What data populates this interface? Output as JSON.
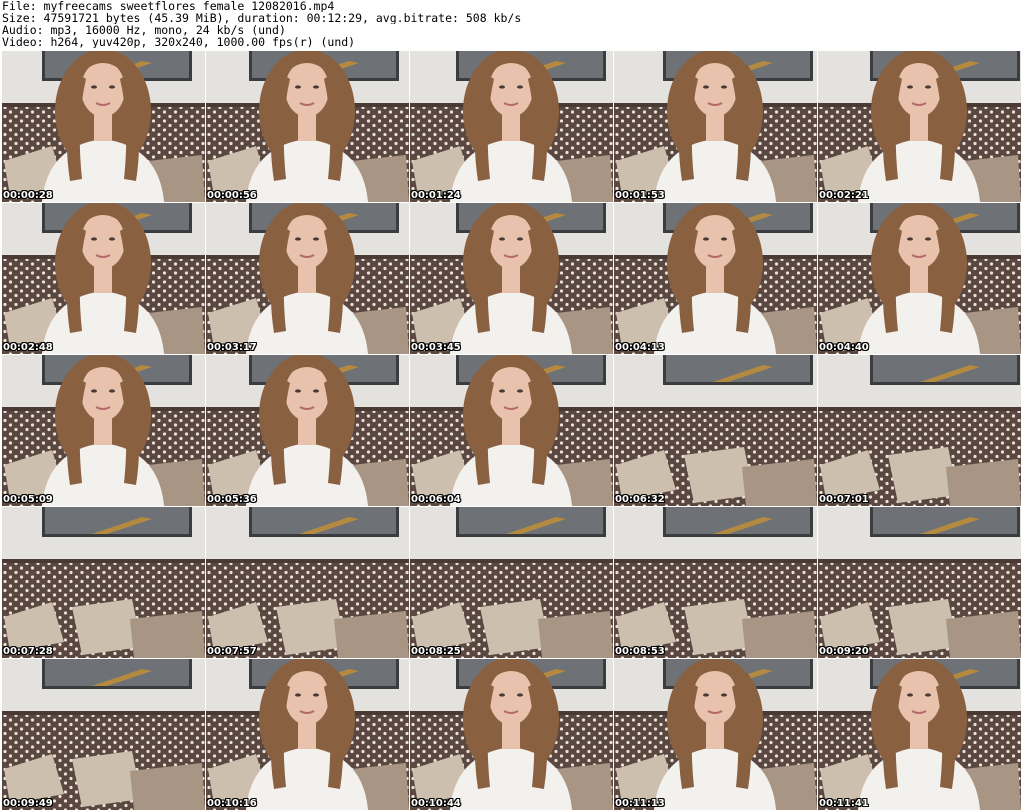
{
  "header": {
    "file_line": "File: myfreecams_sweetflores_female_12082016.mp4",
    "size_line": "Size: 47591721 bytes (45.39 MiB), duration: 00:12:29, avg.bitrate: 508 kb/s",
    "audio_line": "Audio: mp3, 16000 Hz, mono, 24 kb/s (und)",
    "video_line": "Video: h264, yuv420p, 320x240, 1000.00 fps(r) (und)"
  },
  "colors": {
    "background": "#ffffff",
    "wall": "#e4e2de",
    "sofa": "#5a4740",
    "sofa_dots": "#e9e2da",
    "cushion_light": "#cdbfae",
    "cushion_dark": "#a89583",
    "picture_frame": "#3b3c3f",
    "shirt": "#f3f1ee",
    "hair": "#8a6140",
    "skin": "#e8c2ad",
    "timestamp_text": "#ffffff"
  },
  "frames": [
    {
      "timestamp": "00:00:28",
      "scene": "person"
    },
    {
      "timestamp": "00:00:56",
      "scene": "person"
    },
    {
      "timestamp": "00:01:24",
      "scene": "person"
    },
    {
      "timestamp": "00:01:53",
      "scene": "person"
    },
    {
      "timestamp": "00:02:21",
      "scene": "person"
    },
    {
      "timestamp": "00:02:48",
      "scene": "person"
    },
    {
      "timestamp": "00:03:17",
      "scene": "person"
    },
    {
      "timestamp": "00:03:45",
      "scene": "person"
    },
    {
      "timestamp": "00:04:13",
      "scene": "person"
    },
    {
      "timestamp": "00:04:40",
      "scene": "person"
    },
    {
      "timestamp": "00:05:09",
      "scene": "person"
    },
    {
      "timestamp": "00:05:36",
      "scene": "person"
    },
    {
      "timestamp": "00:06:04",
      "scene": "person"
    },
    {
      "timestamp": "00:06:32",
      "scene": "empty"
    },
    {
      "timestamp": "00:07:01",
      "scene": "empty"
    },
    {
      "timestamp": "00:07:28",
      "scene": "empty"
    },
    {
      "timestamp": "00:07:57",
      "scene": "empty"
    },
    {
      "timestamp": "00:08:25",
      "scene": "empty"
    },
    {
      "timestamp": "00:08:53",
      "scene": "empty"
    },
    {
      "timestamp": "00:09:20",
      "scene": "empty"
    },
    {
      "timestamp": "00:09:49",
      "scene": "empty"
    },
    {
      "timestamp": "00:10:16",
      "scene": "person"
    },
    {
      "timestamp": "00:10:44",
      "scene": "person"
    },
    {
      "timestamp": "00:11:13",
      "scene": "person"
    },
    {
      "timestamp": "00:11:41",
      "scene": "person"
    }
  ]
}
